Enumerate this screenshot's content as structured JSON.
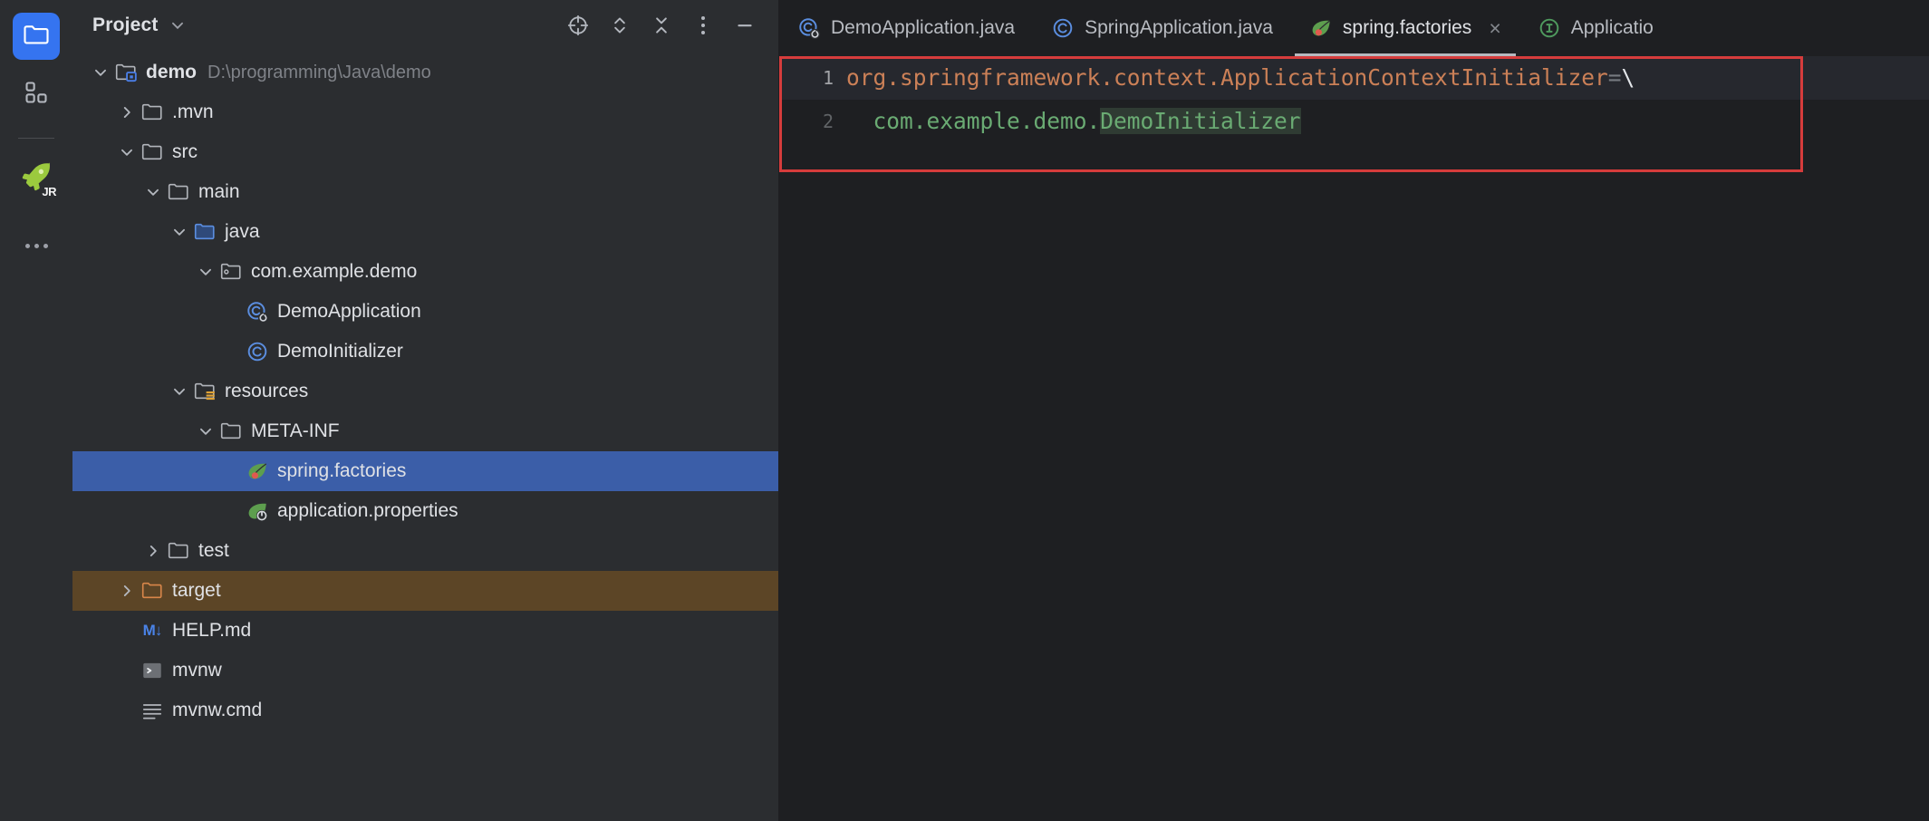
{
  "activity_bar": {
    "items": [
      {
        "name": "project-view",
        "icon": "folder-icon",
        "active": true
      },
      {
        "name": "structure-view",
        "icon": "grid-blocks-icon",
        "active": false
      },
      {
        "name": "jrebel",
        "icon": "rocket-icon",
        "badge": "JR",
        "active": false
      },
      {
        "name": "more-tool-windows",
        "icon": "ellipsis-icon",
        "active": false
      }
    ]
  },
  "project_panel": {
    "title": "Project",
    "title_chevron": "chevron-down-icon",
    "tools": [
      {
        "name": "select-opened-file",
        "icon": "crosshair-target-icon"
      },
      {
        "name": "expand-collapse",
        "icon": "chevron-up-down-icon"
      },
      {
        "name": "collapse-all",
        "icon": "collapse-all-icon"
      },
      {
        "name": "options-menu",
        "icon": "vertical-dots-icon"
      },
      {
        "name": "hide-panel",
        "icon": "minimize-icon"
      }
    ],
    "tree": [
      {
        "label": "demo",
        "path": "D:\\programming\\Java\\demo",
        "depth": 0,
        "twisty": "down",
        "icon": "module-folder-icon",
        "bold": true,
        "state": "normal"
      },
      {
        "label": ".mvn",
        "path": "",
        "depth": 1,
        "twisty": "right",
        "icon": "folder-icon",
        "bold": false,
        "state": "normal"
      },
      {
        "label": "src",
        "path": "",
        "depth": 1,
        "twisty": "down",
        "icon": "folder-icon",
        "bold": false,
        "state": "normal"
      },
      {
        "label": "main",
        "path": "",
        "depth": 2,
        "twisty": "down",
        "icon": "folder-icon",
        "bold": false,
        "state": "normal"
      },
      {
        "label": "java",
        "path": "",
        "depth": 3,
        "twisty": "down",
        "icon": "source-root-folder-icon",
        "bold": false,
        "state": "normal"
      },
      {
        "label": "com.example.demo",
        "path": "",
        "depth": 4,
        "twisty": "down",
        "icon": "package-icon",
        "bold": false,
        "state": "normal"
      },
      {
        "label": "DemoApplication",
        "path": "",
        "depth": 5,
        "twisty": "none",
        "icon": "spring-boot-class-icon",
        "bold": false,
        "state": "normal"
      },
      {
        "label": "DemoInitializer",
        "path": "",
        "depth": 5,
        "twisty": "none",
        "icon": "java-class-icon",
        "bold": false,
        "state": "normal"
      },
      {
        "label": "resources",
        "path": "",
        "depth": 3,
        "twisty": "down",
        "icon": "resource-root-folder-icon",
        "bold": false,
        "state": "normal"
      },
      {
        "label": "META-INF",
        "path": "",
        "depth": 4,
        "twisty": "down",
        "icon": "folder-icon",
        "bold": false,
        "state": "normal"
      },
      {
        "label": "spring.factories",
        "path": "",
        "depth": 5,
        "twisty": "none",
        "icon": "spring-leaf-icon",
        "bold": false,
        "state": "selected"
      },
      {
        "label": "application.properties",
        "path": "",
        "depth": 5,
        "twisty": "none",
        "icon": "spring-properties-icon",
        "bold": false,
        "state": "normal"
      },
      {
        "label": "test",
        "path": "",
        "depth": 2,
        "twisty": "right",
        "icon": "folder-icon",
        "bold": false,
        "state": "normal"
      },
      {
        "label": "target",
        "path": "",
        "depth": 1,
        "twisty": "right",
        "icon": "excluded-folder-icon",
        "bold": false,
        "state": "excluded"
      },
      {
        "label": "HELP.md",
        "path": "",
        "depth": 1,
        "twisty": "none",
        "icon": "markdown-icon",
        "bold": false,
        "state": "normal"
      },
      {
        "label": "mvnw",
        "path": "",
        "depth": 1,
        "twisty": "none",
        "icon": "shell-script-icon",
        "bold": false,
        "state": "normal"
      },
      {
        "label": "mvnw.cmd",
        "path": "",
        "depth": 1,
        "twisty": "none",
        "icon": "text-file-icon",
        "bold": false,
        "state": "normal"
      }
    ]
  },
  "editor": {
    "tabs": [
      {
        "label": "DemoApplication.java",
        "icon": "spring-boot-class-icon",
        "active": false,
        "closable": false
      },
      {
        "label": "SpringApplication.java",
        "icon": "java-class-icon",
        "active": false,
        "closable": false
      },
      {
        "label": "spring.factories",
        "icon": "spring-leaf-icon",
        "active": true,
        "closable": true,
        "close_glyph": "×"
      },
      {
        "label": "Applicatio",
        "icon": "java-interface-icon",
        "active": false,
        "closable": false
      }
    ],
    "line_numbers": [
      "1",
      "2"
    ],
    "code": {
      "line1": {
        "key": "org.springframework.context.ApplicationContextInitializer",
        "eq": "=",
        "escape": "\\"
      },
      "line2": {
        "indent": "  ",
        "package": "com.example.demo.",
        "class_highlighted": "DemoInitializer"
      }
    },
    "annotation": {
      "name": "red-highlight-box",
      "color": "#d63c3c"
    }
  },
  "colors": {
    "accent_blue": "#3574f0",
    "selection_blue": "#3b5ea8",
    "excluded_brown": "#5c4526",
    "panel_bg": "#2b2d30",
    "editor_bg": "#1e1f22",
    "key_orange": "#cb8057",
    "value_green": "#6aab73",
    "annotation_red": "#d63c3c"
  }
}
